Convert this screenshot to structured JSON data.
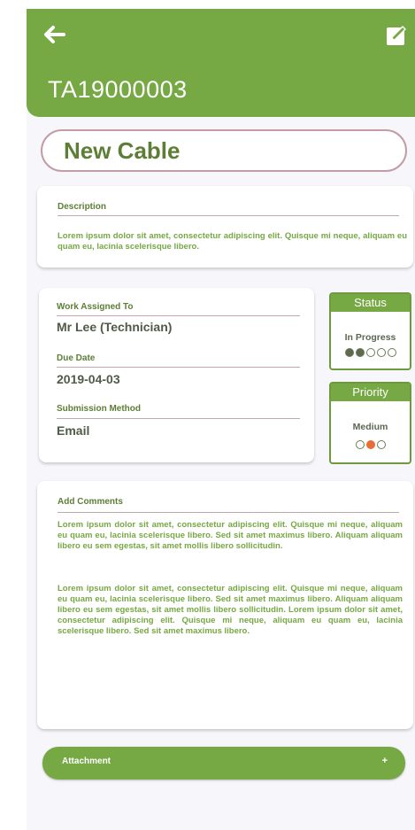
{
  "header": {
    "ticket_id": "TA19000003",
    "back_icon": "back-arrow-icon",
    "edit_icon": "edit-icon",
    "color": "#76a843"
  },
  "title": "New Cable",
  "description": {
    "label": "Description",
    "text": "Lorem ipsum dolor sit amet, consectetur adipiscing elit. Quisque mi neque, aliquam eu quam eu, lacinia scelerisque libero."
  },
  "details": {
    "assigned_label": "Work Assigned To",
    "assigned_value": "Mr Lee (Technician)",
    "due_label": "Due Date",
    "due_value": "2019-04-03",
    "method_label": "Submission Method",
    "method_value": "Email"
  },
  "status": {
    "label": "Status",
    "value": "In Progress",
    "level": 2,
    "of": 5
  },
  "priority": {
    "label": "Priority",
    "value": "Medium",
    "level": 2,
    "of": 3,
    "color": "#e86e37"
  },
  "comments": {
    "label": "Add Comments",
    "paragraph_1": "Lorem ipsum dolor sit amet, consectetur adipiscing elit. Quisque mi neque, aliquam eu quam eu, lacinia scelerisque libero. Sed sit amet maximus libero. Aliquam aliquam libero eu sem egestas, sit amet mollis libero sollicitudin.",
    "paragraph_2": "Lorem ipsum dolor sit amet, consectetur adipiscing elit. Quisque mi neque, aliquam eu quam eu, lacinia scelerisque libero. Sed sit amet maximus libero. Aliquam aliquam libero eu sem egestas, sit amet mollis libero sollicitudin. Lorem ipsum dolor sit amet, consectetur adipiscing elit. Quisque mi neque, aliquam eu quam eu, lacinia scelerisque libero. Sed sit amet maximus libero."
  },
  "attachment": {
    "label": "Attachment",
    "icon": "+"
  }
}
